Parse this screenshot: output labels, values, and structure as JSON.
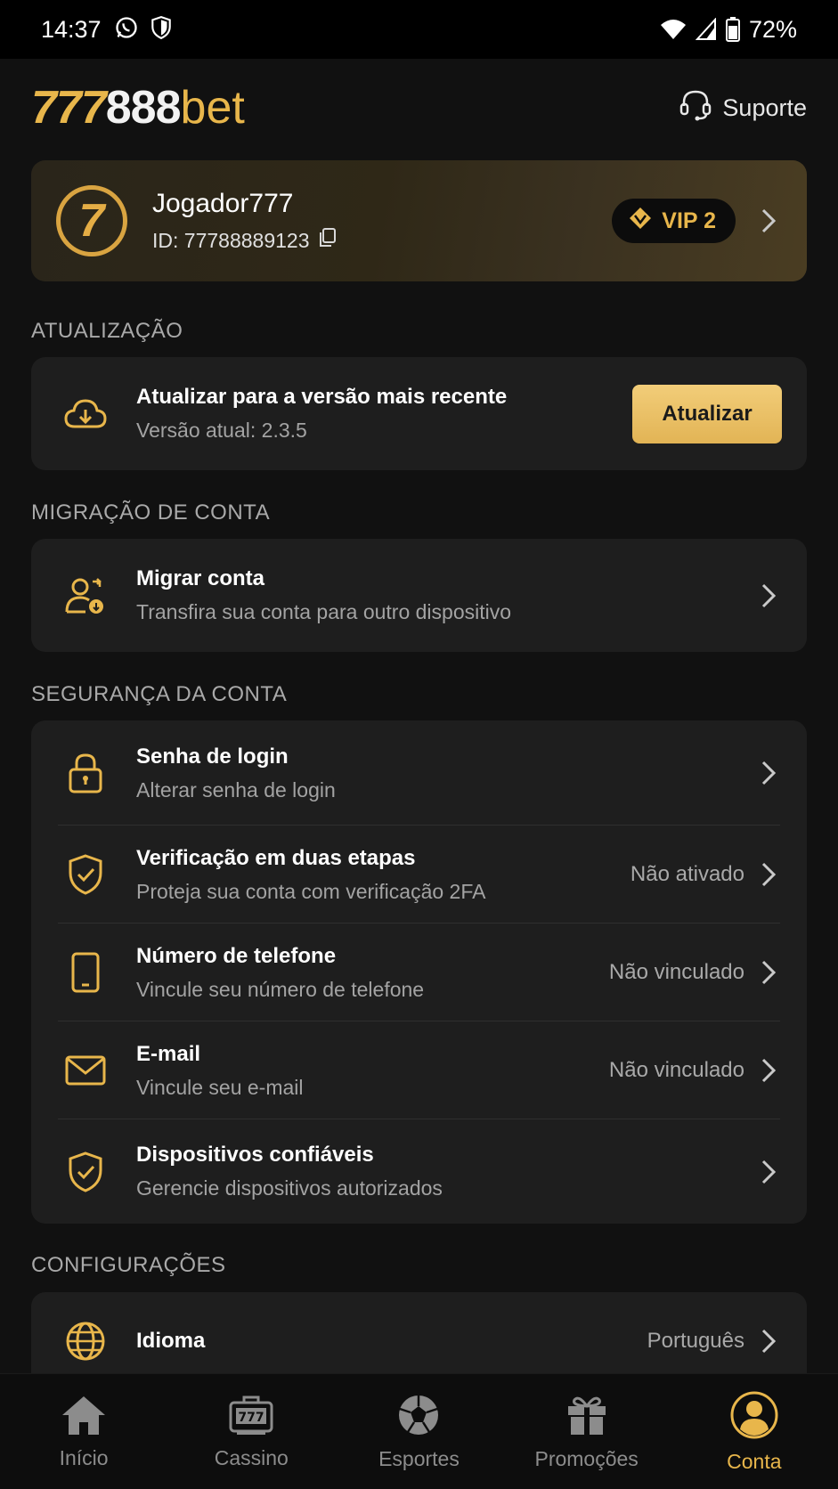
{
  "status_bar": {
    "time": "14:37",
    "battery": "72%"
  },
  "header": {
    "logo_part1": "777",
    "logo_part2": "888",
    "logo_part3": "bet",
    "support_label": "Suporte"
  },
  "profile": {
    "avatar_text": "7",
    "name": "Jogador777",
    "id_label": "ID: 77788889123",
    "vip_label": "VIP 2"
  },
  "sections": {
    "update": {
      "title": "ATUALIZAÇÃO",
      "row_title": "Atualizar para a versão mais recente",
      "row_sub": "Versão atual: 2.3.5",
      "button": "Atualizar"
    },
    "migration": {
      "title": "MIGRAÇÃO DE CONTA",
      "row_title": "Migrar conta",
      "row_sub": "Transfira sua conta para outro dispositivo"
    },
    "security": {
      "title": "SEGURANÇA DA CONTA",
      "items": [
        {
          "title": "Senha de login",
          "sub": "Alterar senha de login",
          "value": ""
        },
        {
          "title": "Verificação em duas etapas",
          "sub": "Proteja sua conta com verificação 2FA",
          "value": "Não ativado"
        },
        {
          "title": "Número de telefone",
          "sub": "Vincule seu número de telefone",
          "value": "Não vinculado"
        },
        {
          "title": "E-mail",
          "sub": "Vincule seu e-mail",
          "value": "Não vinculado"
        },
        {
          "title": "Dispositivos confiáveis",
          "sub": "Gerencie dispositivos autorizados",
          "value": ""
        }
      ]
    },
    "settings": {
      "title": "CONFIGURAÇÕES",
      "language_title": "Idioma",
      "language_value": "Português"
    }
  },
  "nav": [
    {
      "label": "Início",
      "icon": "home-icon"
    },
    {
      "label": "Cassino",
      "icon": "slot-machine-icon"
    },
    {
      "label": "Esportes",
      "icon": "soccer-ball-icon"
    },
    {
      "label": "Promoções",
      "icon": "gift-icon"
    },
    {
      "label": "Conta",
      "icon": "user-icon"
    }
  ],
  "colors": {
    "accent": "#e8b64b",
    "background": "#111111",
    "card": "#1e1e1e"
  }
}
